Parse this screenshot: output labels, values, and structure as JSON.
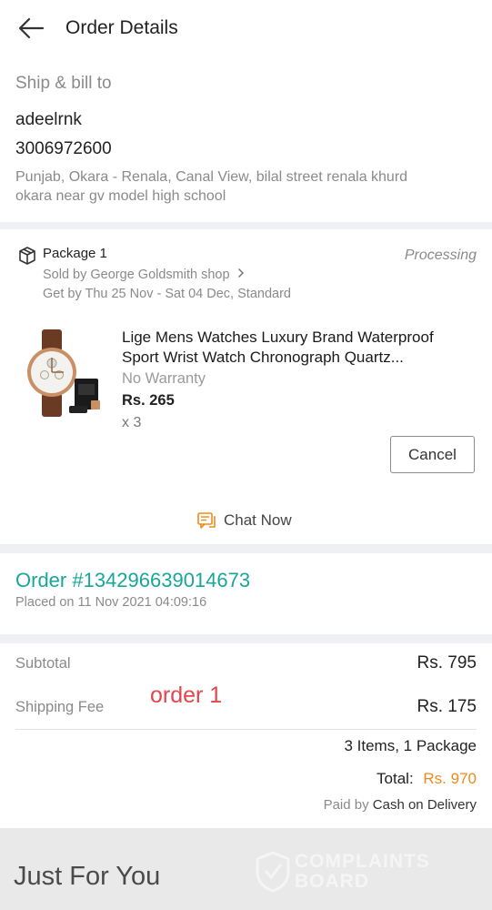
{
  "header": {
    "title": "Order Details",
    "back_icon": "arrow-left-icon"
  },
  "shipping": {
    "section_label": "Ship & bill to",
    "name": "adeelrnk",
    "phone": "3006972600",
    "address_line1": "Punjab, Okara - Renala, Canal View, bilal street renala khurd",
    "address_line2": "okara near gv model high school"
  },
  "package": {
    "title": "Package 1",
    "status": "Processing",
    "seller": "Sold by George Goldsmith shop",
    "delivery": "Get by Thu 25 Nov - Sat 04 Dec, Standard",
    "item": {
      "name_line1": "Lige Mens Watches Luxury Brand Waterproof",
      "name_line2": "Sport Wrist Watch Chronograph Quartz...",
      "warranty": "No Warranty",
      "price": "Rs. 265",
      "quantity": "x 3"
    },
    "cancel_label": "Cancel",
    "chat_label": "Chat Now"
  },
  "order": {
    "number": "Order #134296639014673",
    "placed_on": "Placed on 11 Nov 2021  04:09:16"
  },
  "summary": {
    "subtotal_label": "Subtotal",
    "subtotal_value": "Rs. 795",
    "shipping_label": "Shipping Fee",
    "shipping_value": "Rs. 175",
    "annotation": "order 1",
    "items_count": "3 Items, 1 Package",
    "total_label": "Total:",
    "total_value": "Rs. 970",
    "paid_by_label": "Paid by",
    "payment_method": "Cash on Delivery"
  },
  "recommendations": {
    "title": "Just For You"
  },
  "watermark": {
    "line1": "COMPLAINTS",
    "line2": "BOARD"
  },
  "colors": {
    "accent_teal": "#18a69a",
    "orange": "#f08a1c",
    "annotation_red": "#e5454b",
    "background": "#eff0f3"
  }
}
